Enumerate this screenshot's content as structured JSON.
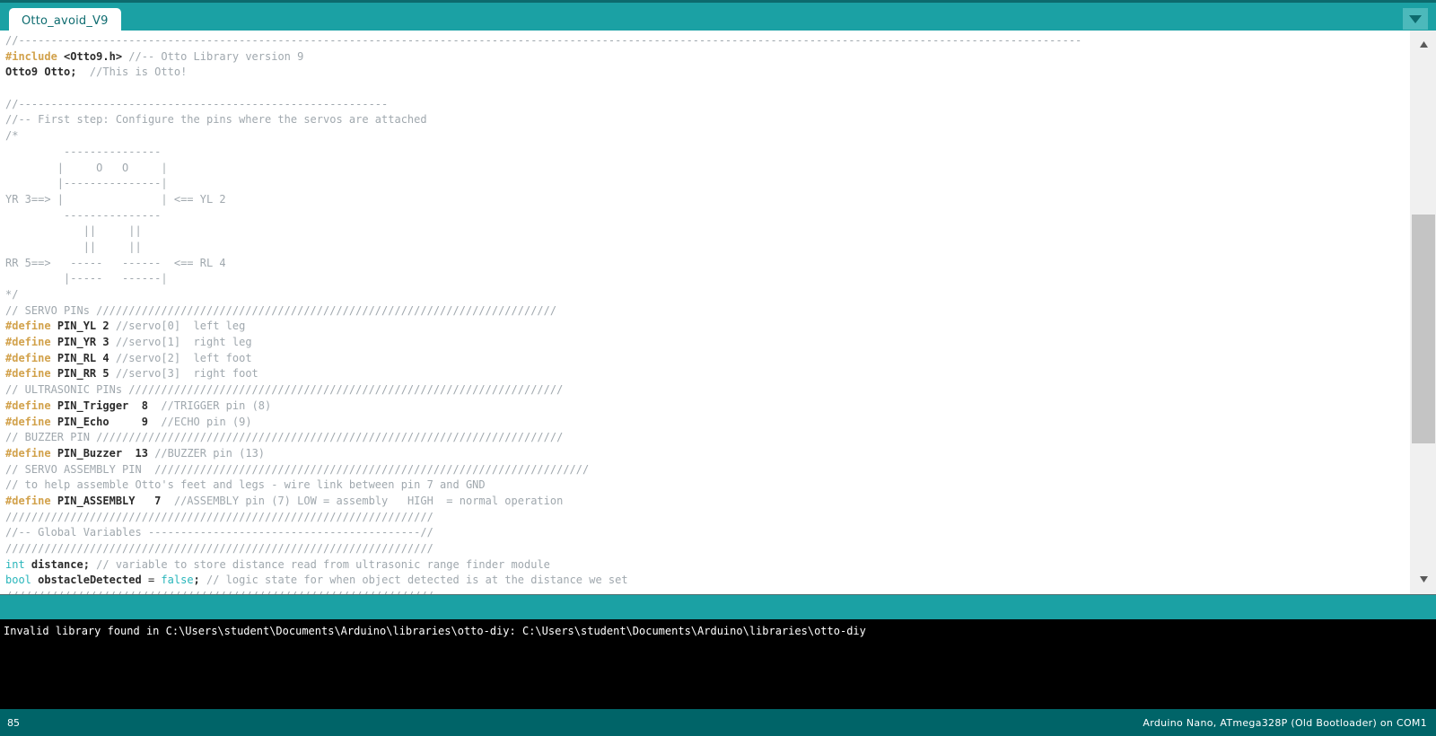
{
  "window": {
    "app": "Arduino IDE",
    "accent_teal": "#1ba1a4",
    "accent_teal_dark": "#006468",
    "console_bg": "#000000"
  },
  "tabbar": {
    "tab_label": "Otto_avoid_V9",
    "dropdown_icon": "chevron-down-icon"
  },
  "editor": {
    "lines": [
      [
        {
          "t": "cm",
          "s": "//--------------------------------------------------------------------------------------------------------------------------------------------------------------------"
        }
      ],
      [
        {
          "t": "pre",
          "s": "#include"
        },
        {
          "t": "pl",
          "s": " "
        },
        {
          "t": "id",
          "s": "<Otto9.h>"
        },
        {
          "t": "cm",
          "s": " //-- Otto Library version 9"
        }
      ],
      [
        {
          "t": "id",
          "s": "Otto9 Otto;"
        },
        {
          "t": "cm",
          "s": "  //This is Otto!"
        }
      ],
      [
        {
          "t": "pl",
          "s": ""
        }
      ],
      [
        {
          "t": "cm",
          "s": "//---------------------------------------------------------"
        }
      ],
      [
        {
          "t": "cm",
          "s": "//-- First step: Configure the pins where the servos are attached"
        }
      ],
      [
        {
          "t": "cm",
          "s": "/*"
        }
      ],
      [
        {
          "t": "cm",
          "s": "         ---------------"
        }
      ],
      [
        {
          "t": "cm",
          "s": "        |     O   O     |"
        }
      ],
      [
        {
          "t": "cm",
          "s": "        |---------------|"
        }
      ],
      [
        {
          "t": "cm",
          "s": "YR 3==> |               | <== YL 2"
        }
      ],
      [
        {
          "t": "cm",
          "s": "         ---------------"
        }
      ],
      [
        {
          "t": "cm",
          "s": "            ||     ||"
        }
      ],
      [
        {
          "t": "cm",
          "s": "            ||     ||"
        }
      ],
      [
        {
          "t": "cm",
          "s": "RR 5==>   -----   ------  <== RL 4"
        }
      ],
      [
        {
          "t": "cm",
          "s": "         |-----   ------|"
        }
      ],
      [
        {
          "t": "cm",
          "s": "*/"
        }
      ],
      [
        {
          "t": "cm",
          "s": "// SERVO PINs ///////////////////////////////////////////////////////////////////////"
        }
      ],
      [
        {
          "t": "pre",
          "s": "#define"
        },
        {
          "t": "pl",
          "s": " "
        },
        {
          "t": "id",
          "s": "PIN_YL 2"
        },
        {
          "t": "cm",
          "s": " //servo[0]  left leg"
        }
      ],
      [
        {
          "t": "pre",
          "s": "#define"
        },
        {
          "t": "pl",
          "s": " "
        },
        {
          "t": "id",
          "s": "PIN_YR 3"
        },
        {
          "t": "cm",
          "s": " //servo[1]  right leg"
        }
      ],
      [
        {
          "t": "pre",
          "s": "#define"
        },
        {
          "t": "pl",
          "s": " "
        },
        {
          "t": "id",
          "s": "PIN_RL 4"
        },
        {
          "t": "cm",
          "s": " //servo[2]  left foot"
        }
      ],
      [
        {
          "t": "pre",
          "s": "#define"
        },
        {
          "t": "pl",
          "s": " "
        },
        {
          "t": "id",
          "s": "PIN_RR 5"
        },
        {
          "t": "cm",
          "s": " //servo[3]  right foot"
        }
      ],
      [
        {
          "t": "cm",
          "s": "// ULTRASONIC PINs ///////////////////////////////////////////////////////////////////"
        }
      ],
      [
        {
          "t": "pre",
          "s": "#define"
        },
        {
          "t": "pl",
          "s": " "
        },
        {
          "t": "id",
          "s": "PIN_Trigger  8"
        },
        {
          "t": "cm",
          "s": "  //TRIGGER pin (8)"
        }
      ],
      [
        {
          "t": "pre",
          "s": "#define"
        },
        {
          "t": "pl",
          "s": " "
        },
        {
          "t": "id",
          "s": "PIN_Echo     9"
        },
        {
          "t": "cm",
          "s": "  //ECHO pin (9)"
        }
      ],
      [
        {
          "t": "cm",
          "s": "// BUZZER PIN ////////////////////////////////////////////////////////////////////////"
        }
      ],
      [
        {
          "t": "pre",
          "s": "#define"
        },
        {
          "t": "pl",
          "s": " "
        },
        {
          "t": "id",
          "s": "PIN_Buzzer  13"
        },
        {
          "t": "cm",
          "s": " //BUZZER pin (13)"
        }
      ],
      [
        {
          "t": "cm",
          "s": "// SERVO ASSEMBLY PIN  ///////////////////////////////////////////////////////////////////"
        }
      ],
      [
        {
          "t": "cm",
          "s": "// to help assemble Otto's feet and legs - wire link between pin 7 and GND"
        }
      ],
      [
        {
          "t": "pre",
          "s": "#define"
        },
        {
          "t": "pl",
          "s": " "
        },
        {
          "t": "id",
          "s": "PIN_ASSEMBLY   7"
        },
        {
          "t": "cm",
          "s": "  //ASSEMBLY pin (7) LOW = assembly   HIGH  = normal operation"
        }
      ],
      [
        {
          "t": "cm",
          "s": "//////////////////////////////////////////////////////////////////"
        }
      ],
      [
        {
          "t": "cm",
          "s": "//-- Global Variables ------------------------------------------//"
        }
      ],
      [
        {
          "t": "cm",
          "s": "//////////////////////////////////////////////////////////////////"
        }
      ],
      [
        {
          "t": "kw",
          "s": "int"
        },
        {
          "t": "pl",
          "s": " "
        },
        {
          "t": "id",
          "s": "distance;"
        },
        {
          "t": "cm",
          "s": " // variable to store distance read from ultrasonic range finder module"
        }
      ],
      [
        {
          "t": "kw",
          "s": "bool"
        },
        {
          "t": "pl",
          "s": " "
        },
        {
          "t": "id",
          "s": "obstacleDetected"
        },
        {
          "t": "pl",
          "s": " = "
        },
        {
          "t": "lit",
          "s": "false"
        },
        {
          "t": "id",
          "s": ";"
        },
        {
          "t": "cm",
          "s": " // logic state for when object detected is at the distance we set"
        }
      ],
      [
        {
          "t": "cm",
          "s": "//////////////////////////////////////////////////////////////////"
        }
      ]
    ]
  },
  "scrollbar": {
    "up_icon": "scroll-up-arrow-icon",
    "down_icon": "scroll-down-arrow-icon"
  },
  "console": {
    "lines": [
      "Invalid library found in C:\\Users\\student\\Documents\\Arduino\\libraries\\otto-diy: C:\\Users\\student\\Documents\\Arduino\\libraries\\otto-diy"
    ]
  },
  "statusbar": {
    "line_number": "85",
    "board_info": "Arduino Nano, ATmega328P (Old Bootloader) on COM1"
  }
}
